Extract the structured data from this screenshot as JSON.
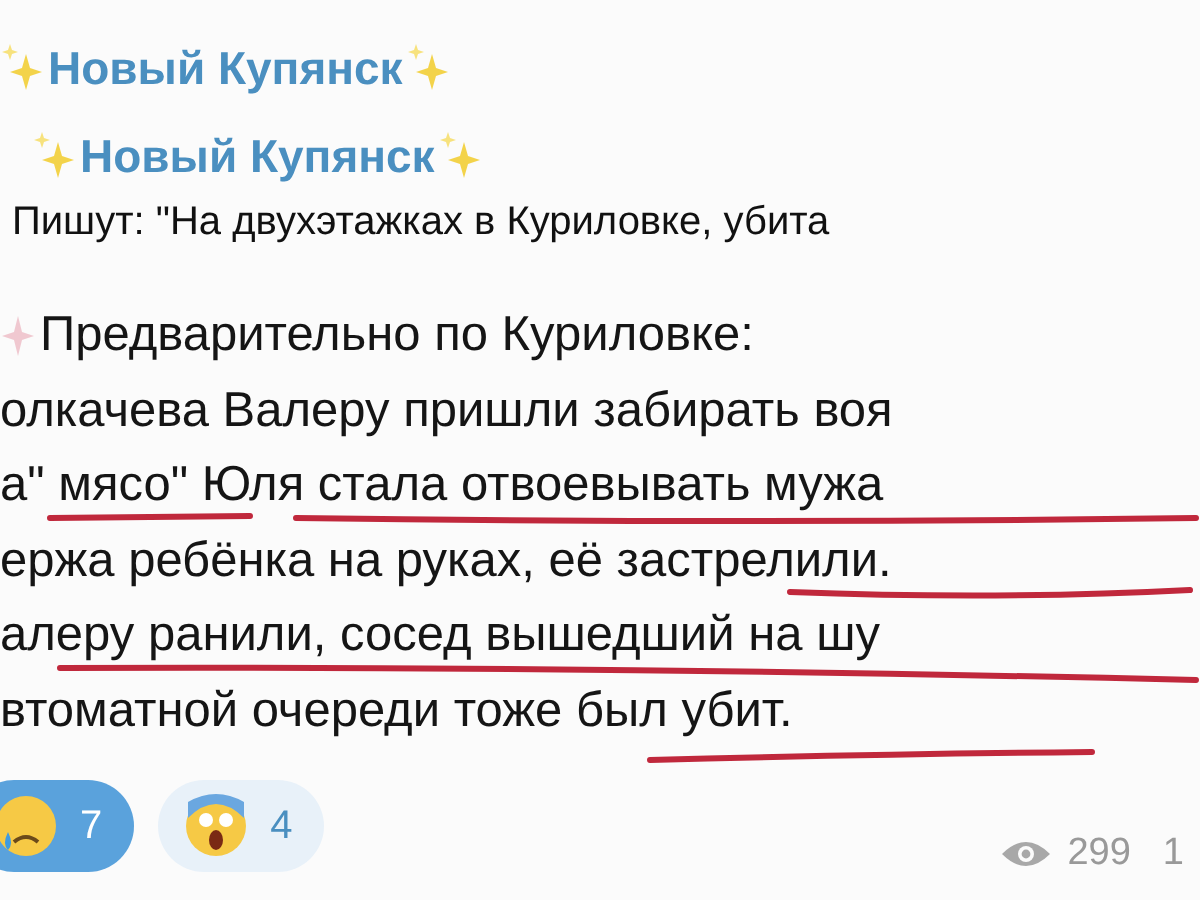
{
  "forwarded_headers": [
    "Новый Купянск",
    "Новый Купянск"
  ],
  "quote": "Пишут: \"На двухэтажках в Куриловке, убита",
  "message_lines": [
    "Предварительно по Куриловке:",
    "олкачева Валеру пришли забирать воя",
    "а\" мясо\" Юля стала отвоевывать мужа",
    "ержа ребёнка на руках, её застрелили.",
    "алеру ранили, сосед вышедший на шу",
    "втоматной очереди тоже был убит."
  ],
  "reactions": [
    {
      "kind": "crying",
      "count": "7",
      "selected": true
    },
    {
      "kind": "screaming",
      "count": "4",
      "selected": false
    }
  ],
  "views": "299",
  "time": "1"
}
